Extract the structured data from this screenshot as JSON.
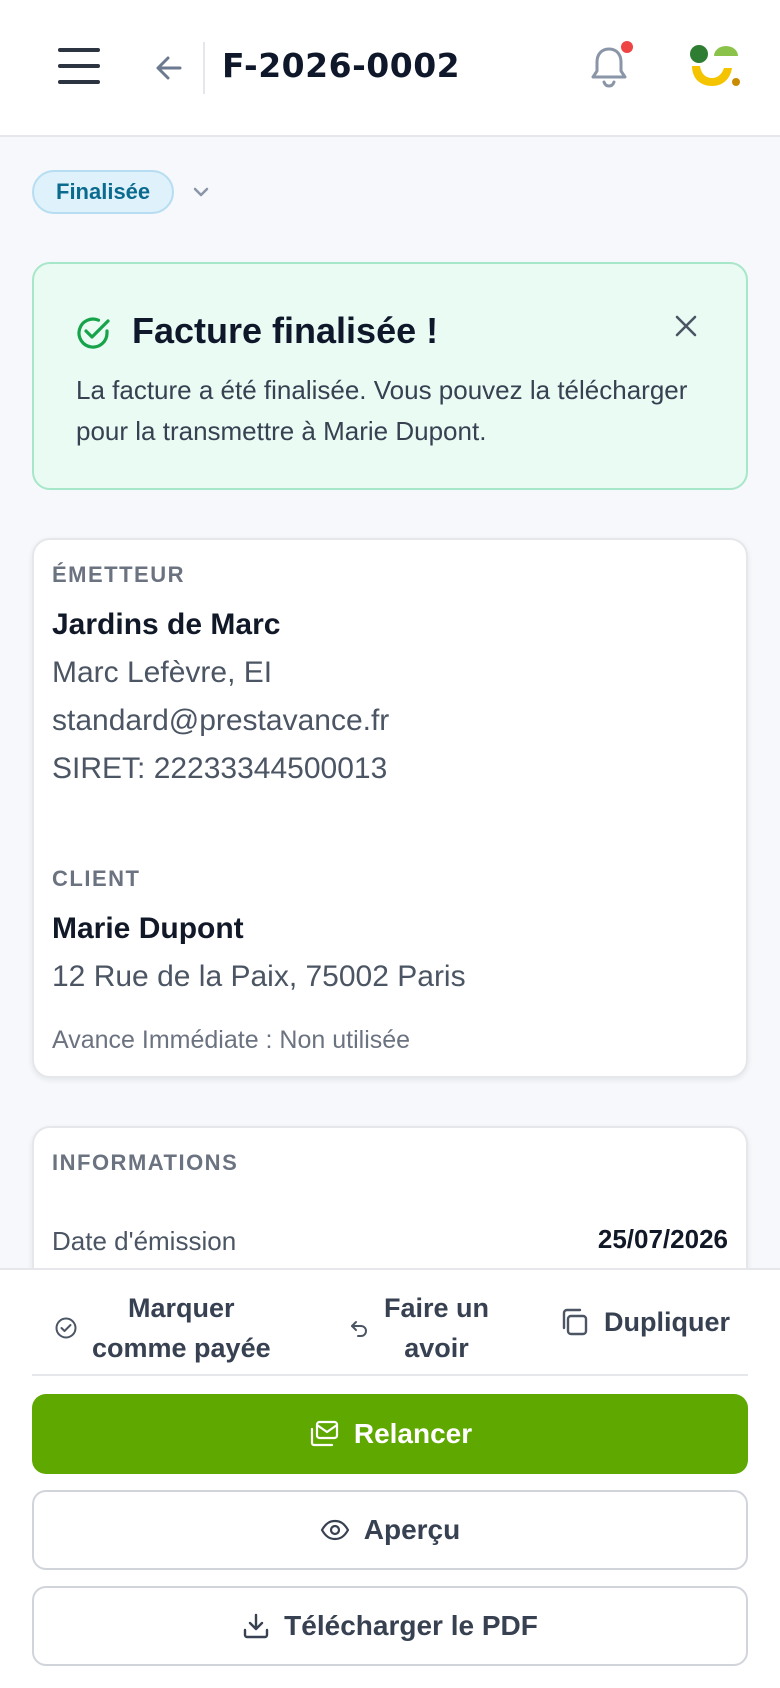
{
  "header": {
    "title": "F-2026-0002"
  },
  "status": {
    "label": "Finalisée"
  },
  "alert": {
    "title": "Facture finalisée !",
    "message": "La facture a été finalisée. Vous pouvez la télécharger pour la transmettre à Marie Dupont."
  },
  "issuer": {
    "section_label": "ÉMETTEUR",
    "name": "Jardins de Marc",
    "owner": "Marc Lefèvre, EI",
    "email": "standard@prestavance.fr",
    "siret": "SIRET: 22233344500013"
  },
  "client": {
    "section_label": "CLIENT",
    "name": "Marie Dupont",
    "address": "12 Rue de la Paix, 75002 Paris",
    "advance": "Avance Immédiate : Non utilisée"
  },
  "info": {
    "section_label": "INFORMATIONS",
    "issue_date_label": "Date d'émission",
    "issue_date_value": "25/07/2026"
  },
  "actions": {
    "mark_paid_line1": "Marquer",
    "mark_paid_line2": "comme payée",
    "credit_line1": "Faire un",
    "credit_line2": "avoir",
    "duplicate": "Dupliquer",
    "remind": "Relancer",
    "preview": "Aperçu",
    "download": "Télécharger le PDF"
  },
  "colors": {
    "primary_green": "#5fa800",
    "success_bg": "#e9fbf3",
    "badge_bg": "#dff1fb",
    "notification_dot": "#ef4444"
  },
  "icons": [
    "menu-icon",
    "arrow-left-icon",
    "bell-icon",
    "chevron-down-icon",
    "check-circle-icon",
    "close-icon",
    "undo-icon",
    "copy-icon",
    "mail-icon",
    "eye-icon",
    "download-icon"
  ]
}
